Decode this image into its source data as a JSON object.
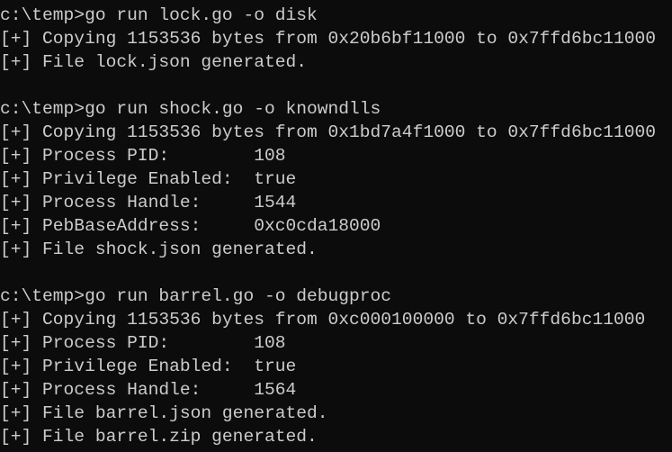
{
  "terminal": {
    "background": "#0c0c0c",
    "foreground": "#cccccc",
    "lines": [
      "c:\\temp>go run lock.go -o disk",
      "[+] Copying 1153536 bytes from 0x20b6bf11000 to 0x7ffd6bc11000",
      "[+] File lock.json generated.",
      "",
      "c:\\temp>go run shock.go -o knowndlls",
      "[+] Copying 1153536 bytes from 0x1bd7a4f1000 to 0x7ffd6bc11000",
      "[+] Process PID:        108",
      "[+] Privilege Enabled:  true",
      "[+] Process Handle:     1544",
      "[+] PebBaseAddress:     0xc0cda18000",
      "[+] File shock.json generated.",
      "",
      "c:\\temp>go run barrel.go -o debugproc",
      "[+] Copying 1153536 bytes from 0xc000100000 to 0x7ffd6bc11000",
      "[+] Process PID:        108",
      "[+] Privilege Enabled:  true",
      "[+] Process Handle:     1564",
      "[+] File barrel.json generated.",
      "[+] File barrel.zip generated."
    ]
  }
}
